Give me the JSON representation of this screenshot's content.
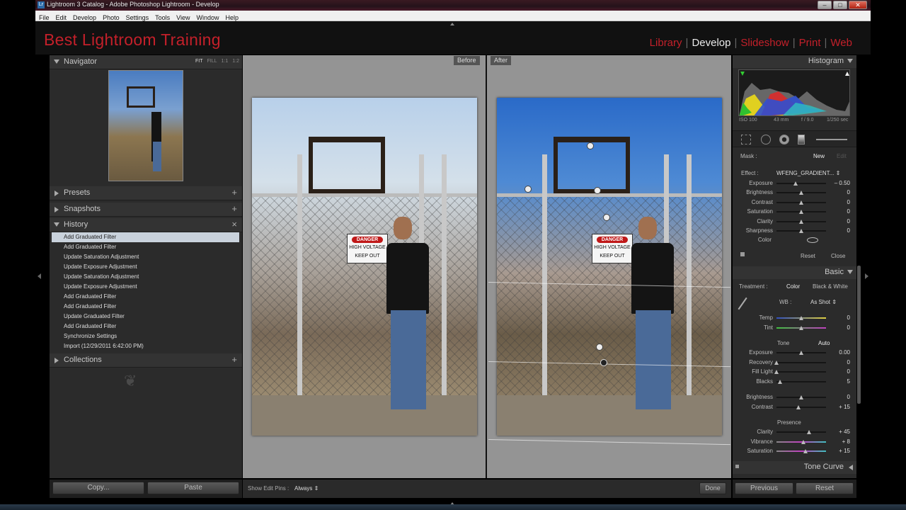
{
  "window": {
    "title": "Lightroom 3 Catalog - Adobe Photoshop Lightroom - Develop",
    "logo": "Lr",
    "controls": {
      "minimize": "–",
      "maximize": "□",
      "close": "✕"
    }
  },
  "menubar": [
    "File",
    "Edit",
    "Develop",
    "Photo",
    "Settings",
    "Tools",
    "View",
    "Window",
    "Help"
  ],
  "brand": "Best Lightroom Training",
  "modules": [
    {
      "label": "Library",
      "active": false
    },
    {
      "label": "Develop",
      "active": true
    },
    {
      "label": "Slideshow",
      "active": false
    },
    {
      "label": "Print",
      "active": false
    },
    {
      "label": "Web",
      "active": false
    }
  ],
  "left_panel": {
    "navigator": {
      "title": "Navigator",
      "modes": [
        "FIT",
        "FILL",
        "1:1",
        "1:2"
      ],
      "selected_mode": "FIT"
    },
    "presets": {
      "title": "Presets",
      "action": "+"
    },
    "snapshots": {
      "title": "Snapshots",
      "action": "+"
    },
    "history": {
      "title": "History",
      "action": "×",
      "items": [
        "Add Graduated Filter",
        "Add Graduated Filter",
        "Update Saturation Adjustment",
        "Update Exposure Adjustment",
        "Update Saturation Adjustment",
        "Update Exposure Adjustment",
        "Add Graduated Filter",
        "Add Graduated Filter",
        "Update Graduated Filter",
        "Add Graduated Filter",
        "Synchronize Settings",
        "Import (12/29/2011 6:42:00 PM)"
      ],
      "selected_index": 0
    },
    "collections": {
      "title": "Collections",
      "action": "+"
    },
    "ornament": "❦",
    "buttons": {
      "copy": "Copy...",
      "paste": "Paste"
    }
  },
  "center": {
    "before_label": "Before",
    "after_label": "After",
    "sign": {
      "top": "DANGER",
      "mid": "HIGH VOLTAGE",
      "bottom": "KEEP OUT"
    },
    "toolbar": {
      "show_pins_label": "Show Edit Pins :",
      "show_pins_value": "Always",
      "done": "Done"
    }
  },
  "right_panel": {
    "histogram": {
      "title": "Histogram",
      "iso": "ISO 100",
      "focal": "43 mm",
      "aperture": "f / 9.0",
      "shutter": "1/250 sec"
    },
    "mask": {
      "label": "Mask :",
      "new": "New",
      "edit": "Edit"
    },
    "effect": {
      "label": "Effect :",
      "preset": "WFENG_GRADIENT...",
      "sliders": [
        {
          "name": "Exposure",
          "value": "– 0.50",
          "pos": 0.38
        },
        {
          "name": "Brightness",
          "value": "0",
          "pos": 0.5
        },
        {
          "name": "Contrast",
          "value": "0",
          "pos": 0.5
        },
        {
          "name": "Saturation",
          "value": "0",
          "pos": 0.5
        },
        {
          "name": "Clarity",
          "value": "0",
          "pos": 0.5
        },
        {
          "name": "Sharpness",
          "value": "0",
          "pos": 0.5
        }
      ],
      "color_label": "Color",
      "reset": "Reset",
      "close": "Close"
    },
    "basic": {
      "title": "Basic",
      "treatment_label": "Treatment :",
      "color": "Color",
      "bw": "Black & White",
      "wb_label": "WB :",
      "wb_value": "As Shot",
      "wb_sliders": [
        {
          "name": "Temp",
          "value": "0",
          "pos": 0.5
        },
        {
          "name": "Tint",
          "value": "0",
          "pos": 0.5
        }
      ],
      "tone_label": "Tone",
      "auto": "Auto",
      "tone_sliders": [
        {
          "name": "Exposure",
          "value": "0.00",
          "pos": 0.5
        },
        {
          "name": "Recovery",
          "value": "0",
          "pos": 0.0
        },
        {
          "name": "Fill Light",
          "value": "0",
          "pos": 0.0
        },
        {
          "name": "Blacks",
          "value": "5",
          "pos": 0.07
        }
      ],
      "bright_sliders": [
        {
          "name": "Brightness",
          "value": "0",
          "pos": 0.5
        },
        {
          "name": "Contrast",
          "value": "+ 15",
          "pos": 0.44
        }
      ],
      "presence_label": "Presence",
      "presence_sliders": [
        {
          "name": "Clarity",
          "value": "+ 45",
          "pos": 0.66
        },
        {
          "name": "Vibrance",
          "value": "+ 8",
          "pos": 0.54
        },
        {
          "name": "Saturation",
          "value": "+ 15",
          "pos": 0.58
        }
      ]
    },
    "tone_curve": {
      "title": "Tone Curve"
    },
    "buttons": {
      "previous": "Previous",
      "reset": "Reset"
    }
  },
  "colors": {
    "brand_red": "#c4202a",
    "panel": "#2b2b2b",
    "canvas": "#949494"
  }
}
